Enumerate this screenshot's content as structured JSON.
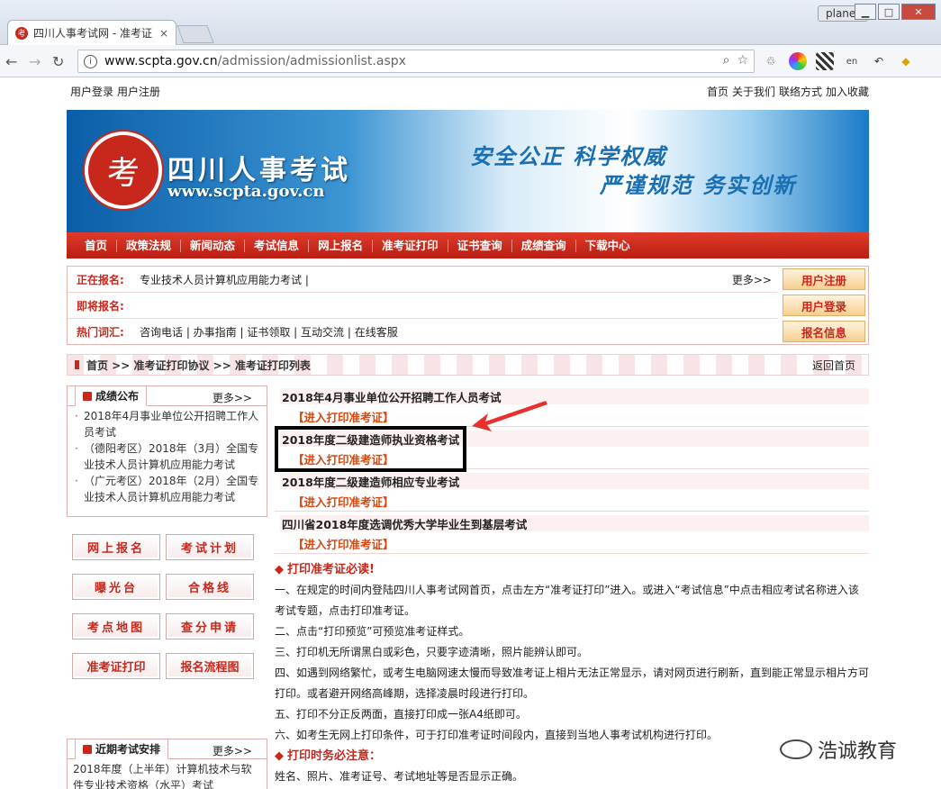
{
  "browser": {
    "tab_title": "四川人事考试网 - 准考证",
    "tab_close": "×",
    "user_badge": "planet",
    "url_host": "www.scpta.gov.cn",
    "url_path": "/admission/admissionlist.aspx"
  },
  "topbar": {
    "left": [
      "用户登录",
      "用户注册"
    ],
    "right": [
      "首页",
      "关于我们",
      "联络方式",
      "加入收藏"
    ]
  },
  "banner": {
    "seal_char": "考",
    "title": "四川人事考试",
    "site_url": "www.scpta.gov.cn",
    "slogan_1": "安全公正 科学权威",
    "slogan_2": "严谨规范 务实创新",
    "colors": {
      "brand_red": "#c8271c",
      "banner_blue": "#0a5ea8"
    }
  },
  "mainnav": [
    "首页",
    "政策法规",
    "新闻动态",
    "考试信息",
    "网上报名",
    "准考证打印",
    "证书查询",
    "成绩查询",
    "下载中心"
  ],
  "infobox": {
    "rows": [
      {
        "label": "正在报名:",
        "text": "专业技术人员计算机应用能力考试 |",
        "more": "更多>>"
      },
      {
        "label": "即将报名:",
        "text": "",
        "more": ""
      },
      {
        "label": "热门词汇:",
        "text": "咨询电话 | 办事指南 | 证书领取 | 互动交流 | 在线客服",
        "more": ""
      }
    ],
    "side_buttons": [
      "用户注册",
      "用户登录",
      "报名信息"
    ]
  },
  "breadcrumb": {
    "path": "首页 >> 准考证打印协议 >> 准考证打印列表",
    "back": "返回首页"
  },
  "results_panel": {
    "title": "成绩公布",
    "more": "更多>>",
    "items": [
      "2018年4月事业单位公开招聘工作人员考试",
      "（德阳考区）2018年（3月）全国专业技术人员计算机应用能力考试",
      "（广元考区）2018年（2月）全国专业技术人员计算机应用能力考试"
    ]
  },
  "quick_buttons": [
    "网上报名",
    "考试计划",
    "曝光台",
    "合格线",
    "考点地图",
    "查分申请",
    "准考证打印",
    "报名流程图"
  ],
  "schedule_panel": {
    "title": "近期考试安排",
    "more": "更多>>",
    "item": "2018年度（上半年）计算机技术与软件专业技术资格（水平）考试"
  },
  "exams": [
    {
      "title": "2018年4月事业单位公开招聘工作人员考试",
      "link": "【进入打印准考证】"
    },
    {
      "title": "2018年度二级建造师执业资格考试",
      "link": "【进入打印准考证】"
    },
    {
      "title": "2018年度二级建造师相应专业考试",
      "link": "【进入打印准考证】"
    },
    {
      "title": "四川省2018年度选调优秀大学毕业生到基层考试",
      "link": "【进入打印准考证】"
    }
  ],
  "notice": {
    "head1": "打印准考证必读!",
    "lines": [
      "一、在规定的时间内登陆四川人事考试网首页，点击左方“准考证打印”进入。或进入“考试信息”中点击相应考试名称进入该考试专题，点击打印准考证。",
      "二、点击“打印预览”可预览准考证样式。",
      "三、打印机无所谓黑白或彩色，只要字迹清晰，照片能辨认即可。",
      "四、如遇到网络繁忙，或考生电脑网速太慢而导致准考证上相片无法正常显示，请对网页进行刷新，直到能正常显示相片方可打印。或者避开网络高峰期，选择凌晨时段进行打印。",
      "五、打印不分正反两面，直接打印成一张A4纸即可。",
      "六、如考生无网上打印条件，可于打印准考证时间段内，直接到当地人事考试机构进行打印。"
    ],
    "head2": "打印时务必注意：",
    "tail": "姓名、照片、准考证号、考试地址等是否显示正确。"
  },
  "watermark": "浩诚教育"
}
